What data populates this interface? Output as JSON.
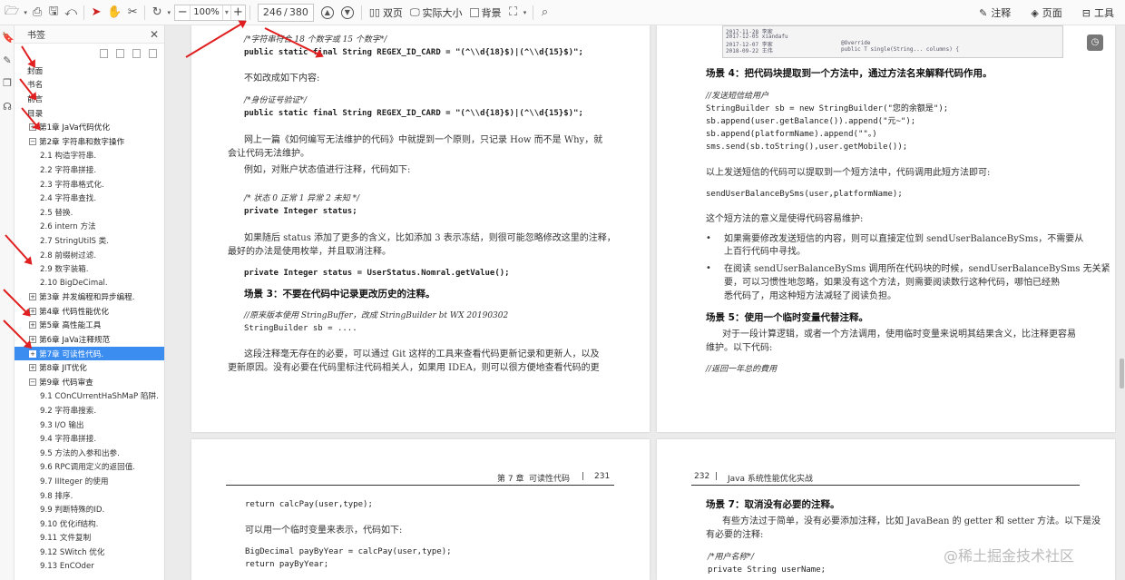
{
  "toolbar": {
    "zoom": "100%",
    "page_current": "246",
    "page_total": "380",
    "double_page": "双页",
    "actual_size": "实际大小",
    "background": "背景",
    "annotate": "注释",
    "page": "页面",
    "tools": "工具"
  },
  "bookmarks": {
    "title": "书签",
    "items": [
      {
        "label": "封面",
        "level": 1,
        "exp": ""
      },
      {
        "label": "书名",
        "level": 1,
        "exp": ""
      },
      {
        "label": "前言",
        "level": 1,
        "exp": ""
      },
      {
        "label": "目录",
        "level": 1,
        "exp": ""
      },
      {
        "label": "第1章 JaVa代码优化",
        "level": 0,
        "exp": "+"
      },
      {
        "label": "第2章 字符串和数字操作",
        "level": 0,
        "exp": "−"
      },
      {
        "label": "2.1 构造字符串.",
        "level": 2,
        "exp": ""
      },
      {
        "label": "2.2 字符串拼接.",
        "level": 2,
        "exp": ""
      },
      {
        "label": "2.3 字符串格式化.",
        "level": 2,
        "exp": ""
      },
      {
        "label": "2.4 字符串查找.",
        "level": 2,
        "exp": ""
      },
      {
        "label": "2.5 替换.",
        "level": 2,
        "exp": ""
      },
      {
        "label": "2.6 intern 方法",
        "level": 2,
        "exp": ""
      },
      {
        "label": "2.7 StringUtilS 类.",
        "level": 2,
        "exp": ""
      },
      {
        "label": "2.8 前缀树过滤.",
        "level": 2,
        "exp": ""
      },
      {
        "label": "2.9 数字装箱.",
        "level": 2,
        "exp": ""
      },
      {
        "label": "2.10 BigDeCimal.",
        "level": 2,
        "exp": ""
      },
      {
        "label": "第3章 并发编程和异步编程.",
        "level": 0,
        "exp": "+"
      },
      {
        "label": "第4章 代码性能优化",
        "level": 0,
        "exp": "+"
      },
      {
        "label": "第5章 高性能工具",
        "level": 0,
        "exp": "+"
      },
      {
        "label": "第6章 JaVa注释规范",
        "level": 0,
        "exp": "+"
      },
      {
        "label": "第7章 可读性代码.",
        "level": 0,
        "exp": "+",
        "selected": true
      },
      {
        "label": "第8章 JIT优化",
        "level": 0,
        "exp": "+"
      },
      {
        "label": "第9章 代码审查",
        "level": 0,
        "exp": "−"
      },
      {
        "label": "9.1 COnCUrrentHaShMaP 陷阱.",
        "level": 2,
        "exp": ""
      },
      {
        "label": "9.2 字符串搜索.",
        "level": 2,
        "exp": ""
      },
      {
        "label": "9.3 I/O 输出",
        "level": 2,
        "exp": ""
      },
      {
        "label": "9.4 字符串拼接.",
        "level": 2,
        "exp": ""
      },
      {
        "label": "9.5 方法的入参和出参.",
        "level": 2,
        "exp": ""
      },
      {
        "label": "9.6 RPC调用定义的返回值.",
        "level": 2,
        "exp": ""
      },
      {
        "label": "9.7 IIIteger 的使用",
        "level": 2,
        "exp": ""
      },
      {
        "label": "9.8 排序.",
        "level": 2,
        "exp": ""
      },
      {
        "label": "9.9 判断特殊的ID.",
        "level": 2,
        "exp": ""
      },
      {
        "label": "9.10 优化if结构.",
        "level": 2,
        "exp": ""
      },
      {
        "label": "9.11 文件复制",
        "level": 2,
        "exp": ""
      },
      {
        "label": "9.12 SWitch 优化",
        "level": 2,
        "exp": ""
      },
      {
        "label": "9.13 EnCOder",
        "level": 2,
        "exp": ""
      }
    ]
  },
  "page_tl": {
    "l1": "/*字符串符合 18 个数字或 15 个数字*/",
    "l2": "public static final String REGEX_ID_CARD = \"(^\\\\d{18}$)|(^\\\\d{15}$)\";",
    "l3": "不如改成如下内容:",
    "l4": "/*身份证号验证*/",
    "l5": "public static final String REGEX_ID_CARD = \"(^\\\\d{18}$)|(^\\\\d{15}$)\";",
    "l6": "网上一篇《如何编写无法维护的代码》中就提到一个原则，只记录 How 而不是 Why，就",
    "l7": "会让代码无法维护。",
    "l8": "例如，对账户状态值进行注释，代码如下:",
    "l9": "/* 状态 0 正常 1 异常 2 未知 */",
    "l10": "private Integer status;",
    "l11": "如果随后 status 添加了更多的含义，比如添加 3 表示冻结，则很可能忽略修改这里的注释，",
    "l12": "最好的办法是使用枚举，并且取消注释。",
    "l13": "private Integer status = UserStatus.Nomral.getValue();",
    "l14": "场景 3：不要在代码中记录更改历史的注释。",
    "l15": "//原来版本使用 StringBuffer，改成 StringBuilder bt WX 20190302",
    "l16": "StringBuilder sb = ....",
    "l17": "这段注释毫无存在的必要，可以通过 Git 这样的工具来查看代码更新记录和更新人，以及",
    "l18": "更新原因。没有必要在代码里标注代码相关人，如果用 IDEA，则可以很方便地查看代码的更"
  },
  "page_tr": {
    "shot": [
      "2017-11-28 李家",
      "2017-12-05 xiandafu",
      "2017-12-07 李家",
      "2018-09-22 王伟",
      "@Override",
      "public T single(String... columns) {"
    ],
    "l1": "场景 4：把代码块提取到一个方法中，通过方法名来解释代码作用。",
    "l2": "//发送短信给用户",
    "l3": "StringBuilder sb = new StringBuilder(\"您的余额是\");",
    "l4": "sb.append(user.getBalance()).append(\"元~\");",
    "l5": "sb.append(platformName).append(\"\"。)",
    "l6": "sms.send(sb.toString(),user.getMobile());",
    "l7": "以上发送短信的代码可以提取到一个短方法中，代码调用此短方法即可:",
    "l8": "sendUserBalanceBySms(user,platformName);",
    "l9": "这个短方法的意义是使得代码容易维护:",
    "l10": "如果需要修改发送短信的内容，则可以直接定位到 sendUserBalanceBySms，不需要从",
    "l11": "上百行代码中寻找。",
    "l12": "在阅读 sendUserBalanceBySms 调用所在代码块的时候，sendUserBalanceBySms 无关紧",
    "l13": "要，可以习惯性地忽略，如果没有这个方法，则需要阅读数行这种代码，哪怕已经熟",
    "l14": "悉代码了，用这种短方法减轻了阅读负担。",
    "l15": "场景 5：使用一个临时变量代替注释。",
    "l16": "对于一段计算逻辑，或者一个方法调用，使用临时变量来说明其结果含义，比注释更容易",
    "l17": "维护。以下代码:",
    "l18": "//返回一年总的費用"
  },
  "page_bl": {
    "header_chapter": "第 7 章",
    "header_title": "可读性代码",
    "header_sep": "|",
    "header_page": "231",
    "l1": "return calcPay(user,type);",
    "l2": "可以用一个临时变量来表示，代码如下:",
    "l3": "BigDecimal payByYear = calcPay(user,type);",
    "l4": "return payByYear;"
  },
  "page_br": {
    "header_page": "232",
    "header_sep": "|",
    "header_title": "Java 系统性能优化实战",
    "l1": "场景 7：取消没有必要的注释。",
    "l2": "有些方法过于简单，没有必要添加注释，比如 JavaBean 的 getter 和 setter 方法。以下是没",
    "l3": "有必要的注释:",
    "l4": "/*用户名称*/",
    "l5": "private String userName;"
  },
  "watermark": "@稀土掘金技术社区",
  "colors": {
    "accent": "#3c8df0",
    "arrow": "#e02020"
  }
}
